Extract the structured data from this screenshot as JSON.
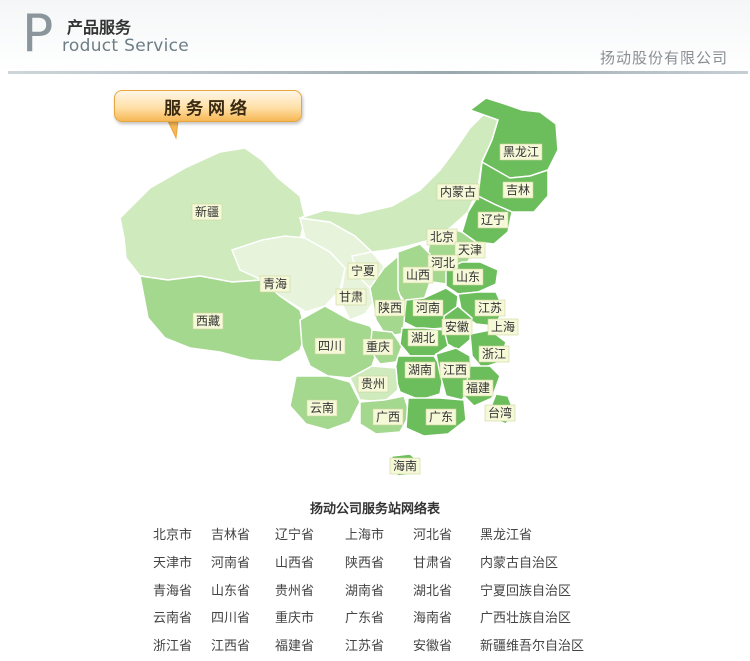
{
  "header": {
    "big_letter": "P",
    "title_cn": "产品服务",
    "title_en": "roduct Service",
    "company": "扬动股份有限公司"
  },
  "map": {
    "tag_label": "服务网络",
    "labels": {
      "heilongjiang": "黑龙江",
      "jilin": "吉林",
      "neimenggu": "内蒙古",
      "liaoning": "辽宁",
      "xinjiang": "新疆",
      "beijing": "北京",
      "tianjin": "天津",
      "hebei": "河北",
      "ningxia": "宁夏",
      "shanxi": "山西",
      "shandong": "山东",
      "qinghai": "青海",
      "gansu": "甘肃",
      "shaanxi": "陕西",
      "henan": "河南",
      "jiangsu": "江苏",
      "xizang": "西藏",
      "anhui": "安徽",
      "shanghai": "上海",
      "hubei": "湖北",
      "sichuan": "四川",
      "chongqing": "重庆",
      "zhejiang": "浙江",
      "hunan": "湖南",
      "jiangxi": "江西",
      "guizhou": "贵州",
      "fujian": "福建",
      "yunnan": "云南",
      "guangxi": "广西",
      "guangdong": "广东",
      "taiwan": "台湾",
      "hainan": "海南"
    },
    "colors": {
      "dark": "#6cbd5c",
      "mid": "#a4d88e",
      "light": "#cfeabc",
      "pale": "#e7f4db",
      "border": "#ffffff"
    }
  },
  "table": {
    "title": "扬动公司服务站网络表",
    "columns": [
      [
        "北京市",
        "天津市",
        "青海省",
        "云南省",
        "浙江省"
      ],
      [
        "吉林省",
        "河南省",
        "山东省",
        "四川省",
        "江西省"
      ],
      [
        "辽宁省",
        "山西省",
        "贵州省",
        "重庆市",
        "福建省"
      ],
      [
        "上海市",
        "陕西省",
        "湖南省",
        "广东省",
        "江苏省"
      ],
      [
        "河北省",
        "甘肃省",
        "湖北省",
        "海南省",
        "安徽省"
      ],
      [
        "黑龙江省",
        "内蒙古自治区",
        "宁夏回族自治区",
        "广西壮族自治区",
        "新疆维吾尔自治区"
      ]
    ]
  }
}
